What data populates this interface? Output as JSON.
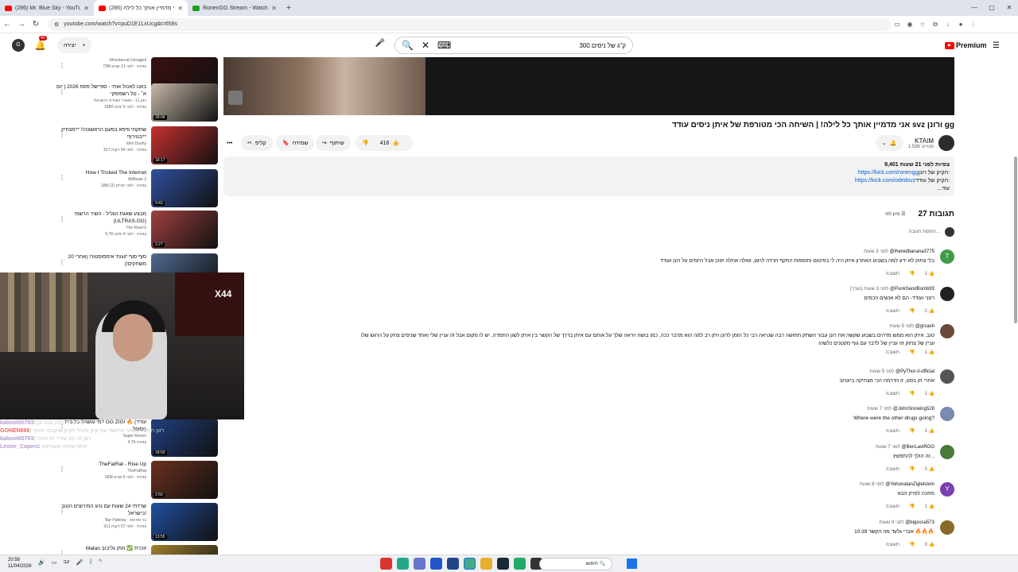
{
  "browser": {
    "tabs": [
      {
        "title": "(286) Mr. Blue Sky - YouTube",
        "active": false
      },
      {
        "title": "אני מדמיין אותך כל לילה (286)",
        "active": true
      },
      {
        "title": "RonenGG Stream - Watch Live",
        "active": false
      }
    ],
    "url": "youtube.com/watch?v=puD1E1LxUcg&t=658s"
  },
  "header": {
    "notif_count": "40",
    "create_label": "יצירה",
    "search_query": "300 ק\"ג של ניסים",
    "logo": "Premium"
  },
  "video": {
    "title": "אני מדמיין אותך כל לילה! | השיחה הכי מטורפת של איתן ניסים עודד svz ורונן gg",
    "channel": "KTAIM",
    "subscribers": "1.53K מנויים",
    "likes": "416",
    "share": "שיתוף",
    "save": "שמירה",
    "clip": "קליפ",
    "desc_stats": "9,401 צפיות לפני 21 שעות",
    "desc_line1": "https://kick.com/ronengg",
    "desc_line1_prefix": "הקיק של רונן:",
    "desc_line2": "https://kick.com/odedsvz",
    "desc_line2_prefix": "הקיק של עודד:",
    "desc_more": "...עוד"
  },
  "comments_section": {
    "count": "27 תגובות",
    "sort": "מיון לפי",
    "add": "הוספת תגובה..."
  },
  "comments": [
    {
      "user": "@theredbanana3775",
      "time": "לפני 3 שעות",
      "text": "בלי צחוק לא ידע למה בשבוע האחרון איתן היה לי בפיטום ותוספות התקף חרדה לרגע, וואלה אחלה תוכן אבל רחמים על רונן ועודד",
      "likes": "1",
      "reply": "תשובה",
      "avatar": "T",
      "color": "#3f9b4a"
    },
    {
      "user": "@PunkSendBomb93",
      "time": "לפני 3 שעות (נערך)",
      "text": "רונני ועודד- הם לא אנשים הכמים",
      "likes": "2",
      "reply": "תשובה",
      "avatar": "",
      "color": "#222"
    },
    {
      "user": "@grsash",
      "time": "לפני 5 שעות",
      "text": "טוב, איתן הוא ממש מדהים בשבוע שקשה את רונן עבור השתק תחושה רבה שנראה רבי כל הזמן לרונן ויתן רב למה הוא מדבר ככה, כמו בושה ויראה שלך על אותם עם איתן בדרך של הקשר בין איתן לשון החמדה, יש לו מקום אבל זה עניין שלי ואחד שניסים צחק על הרגש שלו",
      "text2": "עניין של צחוק זה עניין של לדבר עם גוף מקטנים כלשהו",
      "likes": "1",
      "reply": "תשובה",
      "avatar": "",
      "color": "#6b4a3a"
    },
    {
      "user": "@PyThor-il-official",
      "time": "לפני 5 שעות",
      "text": "אחרי חן בסט, זו הדרמה הכי מצחיקה ביוטיוב",
      "likes": "1",
      "reply": "תשובה",
      "avatar": "",
      "color": "#555"
    },
    {
      "user": "@JohnSnowing528",
      "time": "לפני 7 שעות",
      "text": "Where were the other drugs going?",
      "likes": "1",
      "reply": "תשובה",
      "avatar": "",
      "color": "#7a8ab0"
    },
    {
      "user": "@BenLaviRGG",
      "time": "לפני 7 שעות",
      "text": "זה הולך להתפוצץ...",
      "likes": "3",
      "reply": "תשובה",
      "avatar": "",
      "color": "#4a7a3a"
    },
    {
      "user": "@YehonatanZiglelstein",
      "time": "לפני 8 שעות",
      "text": "מחכה לפרק הבא",
      "likes": "1",
      "reply": "תשובה",
      "avatar": "Y",
      "color": "#7b3fb0"
    },
    {
      "user": "@bigsosa573",
      "time": "לפני 9 שעות",
      "text": "10:39 אברי גלעד מה הקשר 🔥🔥🔥",
      "likes": "3",
      "reply": "תשובה",
      "avatar": "",
      "color": "#8a6a2a"
    }
  ],
  "recommendations": [
    {
      "title": "",
      "channel": "Monstercat Uncaged",
      "stats": "73M צפיות · לפני 11 שנים",
      "duration": "4:31",
      "thumb": "#3a1010"
    },
    {
      "title": "באנו לאכול אותי - ספיישל פסח 2026 | יום א׳ - טל רשפופקי",
      "channel": "כאן 11 - תאגיד השידור הישראלי",
      "stats": "168K צפיות · לפני 5 ימים",
      "duration": "28:04",
      "thumb": "#c8b8a8"
    },
    {
      "title": "שתקתי פיפא בפעם הראשונה!! **מצחיק בטירוף**",
      "channel": "Iden Dushy",
      "stats": "517 צפיות · לפני 54 דקות",
      "duration": "18:17",
      "thumb": "#c83030"
    },
    {
      "title": "How I Tricked The Internet",
      "channel": "MrBeast 2",
      "stats": "18M צפיות · לפני יומיים (2)",
      "duration": "9:43",
      "thumb": "#3050a0"
    },
    {
      "title": "מבצע שאגת הגליל - השיר הרשמי (ULTRAS.GG)",
      "channel": "The Real G",
      "stats": "6.7K צפיות · לפני 4 ימים",
      "duration": "2:27",
      "thumb": "#a04040"
    },
    {
      "title": "סוף סוף 'זוגות' אימפוסטור! (אחרי 20 משחקים!)",
      "channel": "",
      "stats": "",
      "duration": "",
      "thumb": "#506a90"
    },
    {
      "title": "מי עושה? כל בית? GG ZIG! 🔥 (עודד וסופל)",
      "channel": "Super Renon",
      "stats": "4.7K צפיות",
      "duration": "18:50",
      "thumb": "#204080"
    },
    {
      "title": "TheFatRat - Rise Up",
      "channel": "TheFatRat",
      "stats": "56M צפיות · לפני 6 שנים",
      "duration": "2:50",
      "thumb": "#6a3020"
    },
    {
      "title": "שרדתי 24 שעות עם נהג המירוצים הטוב בישראל!",
      "channel": "Bar Pahima · בר פחימה",
      "stats": "311 צפיות · לפני 57 דקות",
      "duration": "13:55",
      "thumb": "#2050a0"
    },
    {
      "title": "Matan זוכרת ✅ מתן גליבוב",
      "channel": "",
      "stats": "",
      "duration": "",
      "thumb": "#a08030"
    }
  ],
  "chat": [
    {
      "user": "kaboold0703",
      "text": "כן! GG ZIG על עודד"
    },
    {
      "user": "GONEN666",
      "text": "רונן תיכנס לאתר הרשמי של קיק ותגיד לקיק שיקבלו אותך"
    },
    {
      "user": "kaboold0703",
      "text": "רונן זה לא עודד זה אתה"
    },
    {
      "user": "Lester_Capers",
      "text": "איזה שיחה מטורפת"
    }
  ],
  "webcam": {
    "overlay": "X44"
  },
  "taskbar": {
    "time": "20:58",
    "date": "11/04/2026",
    "lang": "עב",
    "search": "חיפוש"
  }
}
